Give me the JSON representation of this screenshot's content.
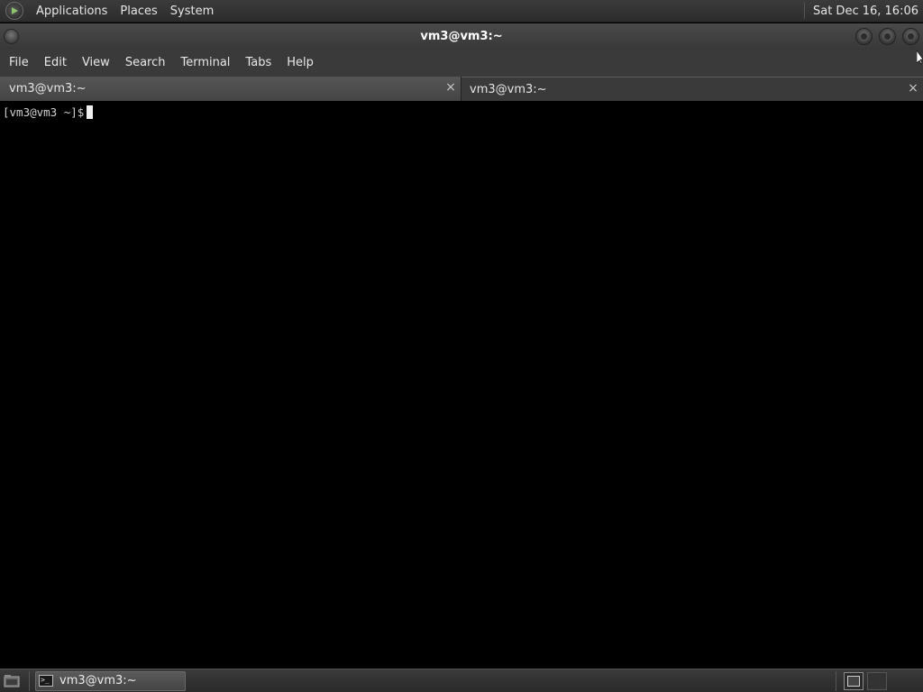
{
  "top_panel": {
    "menus": [
      "Applications",
      "Places",
      "System"
    ],
    "clock": "Sat Dec 16, 16:06"
  },
  "window": {
    "title": "vm3@vm3:~"
  },
  "menubar": {
    "items": [
      "File",
      "Edit",
      "View",
      "Search",
      "Terminal",
      "Tabs",
      "Help"
    ]
  },
  "tabs": [
    {
      "label": "vm3@vm3:~",
      "close": "×"
    },
    {
      "label": "vm3@vm3:~",
      "close": "×"
    }
  ],
  "terminal": {
    "prompt": "[vm3@vm3 ~]$"
  },
  "taskbar": {
    "task_label": "vm3@vm3:~",
    "term_icon_glyph": ">_"
  },
  "colors": {
    "panel": "#2c2c2c",
    "terminal_bg": "#000000",
    "text": "#e6e6e6"
  }
}
